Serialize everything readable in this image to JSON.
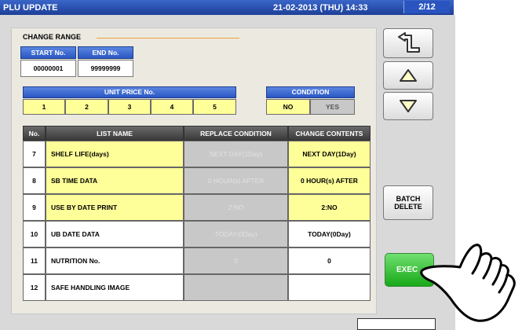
{
  "titlebar": {
    "title": "PLU UPDATE",
    "datetime": "21-02-2013 (THU)  14:33",
    "page": "2/12"
  },
  "change_range": {
    "label": "CHANGE RANGE",
    "start_label": "START No.",
    "end_label": "END No.",
    "start_value": "00000001",
    "end_value": "99999999"
  },
  "unit_price": {
    "label": "UNIT PRICE No.",
    "options": [
      "1",
      "2",
      "3",
      "4",
      "5"
    ]
  },
  "condition": {
    "label": "CONDITION",
    "no": "NO",
    "yes": "YES",
    "selected": "NO"
  },
  "table": {
    "headers": {
      "no": "No.",
      "name": "LIST NAME",
      "replace": "REPLACE CONDITION",
      "change": "CHANGE CONTENTS"
    },
    "rows": [
      {
        "no": "7",
        "name": "SHELF LIFE(days)",
        "replace": "NEXT DAY(1Day)",
        "change": "NEXT DAY(1Day)",
        "highlight": true
      },
      {
        "no": "8",
        "name": "SB TIME DATA",
        "replace": "0 HOUR(s) AFTER",
        "change": "0 HOUR(s) AFTER",
        "highlight": true
      },
      {
        "no": "9",
        "name": "USE BY DATE PRINT",
        "replace": "2:NO",
        "change": "2:NO",
        "highlight": true
      },
      {
        "no": "10",
        "name": "UB DATE DATA",
        "replace": "TODAY(0Day)",
        "change": "TODAY(0Day)",
        "highlight": false
      },
      {
        "no": "11",
        "name": "NUTRITION No.",
        "replace": "0",
        "change": "0",
        "highlight": false
      },
      {
        "no": "12",
        "name": "SAFE HANDLING IMAGE",
        "replace": "",
        "change": "",
        "highlight": false
      }
    ]
  },
  "side": {
    "batch_delete": "BATCH DELETE",
    "execute": "EXEC"
  },
  "icons": [
    "return-icon",
    "arrow-up-icon",
    "arrow-down-icon",
    "pointing-hand-icon"
  ],
  "colors": {
    "titlebar": "#1d3f98",
    "highlight": "#ffff99",
    "exec": "#18a818",
    "header_blue": "#2a57c4"
  }
}
